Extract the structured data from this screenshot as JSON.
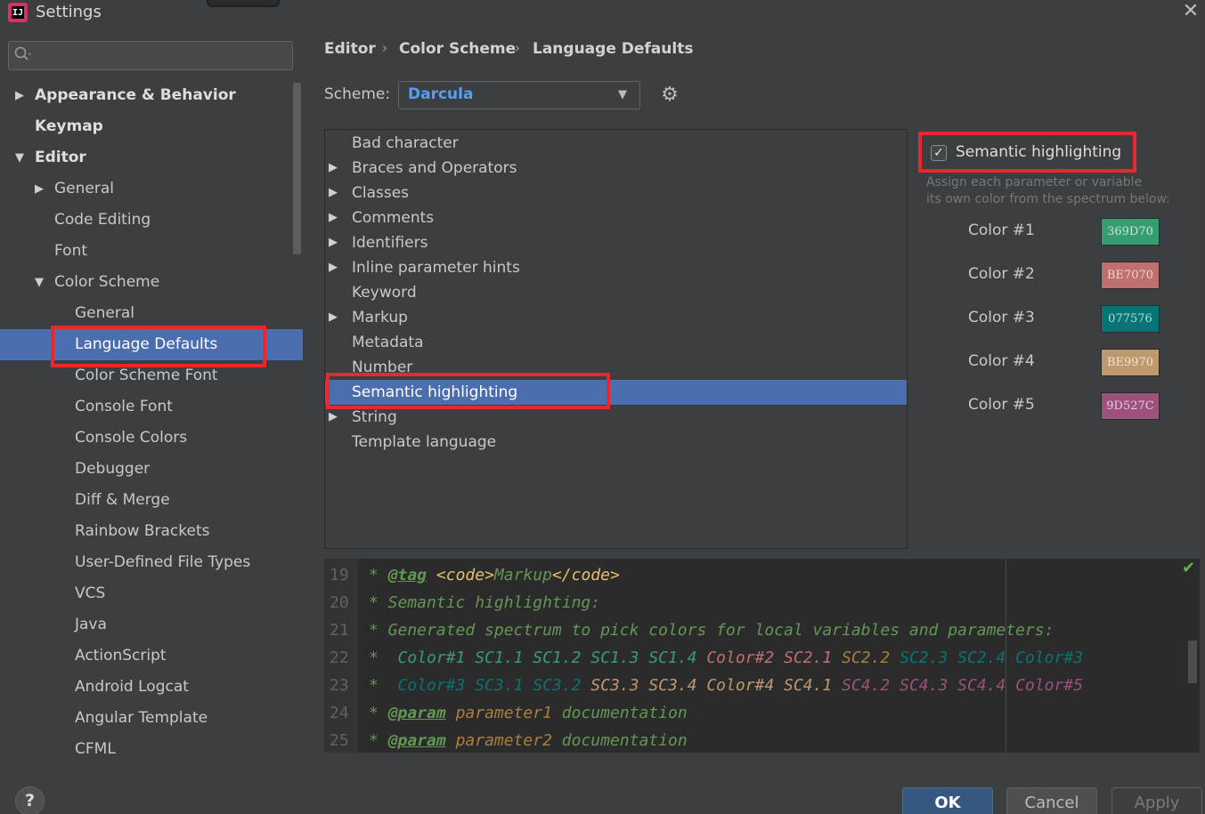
{
  "window": {
    "title": "Settings",
    "app_icon": "intellij-icon",
    "close_icon": "close-icon"
  },
  "search": {
    "placeholder": "",
    "icon": "search-icon"
  },
  "sidebar": {
    "items": [
      {
        "label": "Appearance & Behavior",
        "level": 0,
        "bold": true,
        "expanded": false,
        "expandable": true
      },
      {
        "label": "Keymap",
        "level": 0,
        "bold": true,
        "expandable": false
      },
      {
        "label": "Editor",
        "level": 0,
        "bold": true,
        "expanded": true,
        "expandable": true
      },
      {
        "label": "General",
        "level": 1,
        "expanded": false,
        "expandable": true
      },
      {
        "label": "Code Editing",
        "level": 1
      },
      {
        "label": "Font",
        "level": 1
      },
      {
        "label": "Color Scheme",
        "level": 1,
        "expanded": true,
        "expandable": true
      },
      {
        "label": "General",
        "level": 2
      },
      {
        "label": "Language Defaults",
        "level": 2,
        "selected": true
      },
      {
        "label": "Color Scheme Font",
        "level": 2
      },
      {
        "label": "Console Font",
        "level": 2
      },
      {
        "label": "Console Colors",
        "level": 2
      },
      {
        "label": "Debugger",
        "level": 2
      },
      {
        "label": "Diff & Merge",
        "level": 2
      },
      {
        "label": "Rainbow Brackets",
        "level": 2
      },
      {
        "label": "User-Defined File Types",
        "level": 2
      },
      {
        "label": "VCS",
        "level": 2
      },
      {
        "label": "Java",
        "level": 2
      },
      {
        "label": "ActionScript",
        "level": 2
      },
      {
        "label": "Android Logcat",
        "level": 2
      },
      {
        "label": "Angular Template",
        "level": 2
      },
      {
        "label": "CFML",
        "level": 2
      }
    ]
  },
  "breadcrumb": {
    "items": [
      "Editor",
      "Color Scheme",
      "Language Defaults"
    ],
    "separator": "›"
  },
  "scheme": {
    "label": "Scheme:",
    "value": "Darcula",
    "settings_icon": "gear-icon"
  },
  "tree": {
    "items": [
      {
        "label": "Bad character",
        "expandable": false
      },
      {
        "label": "Braces and Operators",
        "expandable": true
      },
      {
        "label": "Classes",
        "expandable": true
      },
      {
        "label": "Comments",
        "expandable": true
      },
      {
        "label": "Identifiers",
        "expandable": true
      },
      {
        "label": "Inline parameter hints",
        "expandable": true
      },
      {
        "label": "Keyword",
        "expandable": false
      },
      {
        "label": "Markup",
        "expandable": true
      },
      {
        "label": "Metadata",
        "expandable": false
      },
      {
        "label": "Number",
        "expandable": false
      },
      {
        "label": "Semantic highlighting",
        "expandable": false,
        "selected": true
      },
      {
        "label": "String",
        "expandable": true
      },
      {
        "label": "Template language",
        "expandable": false
      }
    ]
  },
  "semantic": {
    "checkbox_label": "Semantic highlighting",
    "checked": true,
    "hint_line1": "Assign each parameter or variable",
    "hint_line2": "its own color from the spectrum below:",
    "colors": [
      {
        "label": "Color #1",
        "hex": "369D70",
        "fg": "#c8e6d6"
      },
      {
        "label": "Color #2",
        "hex": "BE7070",
        "fg": "#f0d0d0"
      },
      {
        "label": "Color #3",
        "hex": "077576",
        "fg": "#b6dede"
      },
      {
        "label": "Color #4",
        "hex": "BE9970",
        "fg": "#f3e2cc"
      },
      {
        "label": "Color #5",
        "hex": "9D527C",
        "fg": "#e9c9dc"
      }
    ]
  },
  "preview": {
    "lines": [
      {
        "n": "19",
        "segs": [
          [
            "* ",
            ""
          ],
          [
            "@tag",
            "tg"
          ],
          [
            " ",
            ""
          ],
          [
            "<code>",
            "mk"
          ],
          [
            "Markup",
            ""
          ],
          [
            "</code>",
            "mk"
          ]
        ]
      },
      {
        "n": "20",
        "segs": [
          [
            "* Semantic highlighting:",
            ""
          ]
        ]
      },
      {
        "n": "21",
        "segs": [
          [
            "* Generated spectrum to pick colors for local variables and parameters:",
            ""
          ]
        ]
      },
      {
        "n": "22",
        "segs": [
          [
            "*  ",
            ""
          ],
          [
            "Color#1",
            "c1"
          ],
          [
            " ",
            ""
          ],
          [
            "SC1.1",
            "c1"
          ],
          [
            " ",
            ""
          ],
          [
            "SC1.2",
            "c1"
          ],
          [
            " ",
            ""
          ],
          [
            "SC1.3",
            "c1"
          ],
          [
            " ",
            ""
          ],
          [
            "SC1.4",
            "c1"
          ],
          [
            " ",
            ""
          ],
          [
            "Color#2",
            "c2"
          ],
          [
            " ",
            ""
          ],
          [
            "SC2.1",
            "c2"
          ],
          [
            " ",
            ""
          ],
          [
            "SC2.2",
            "pm"
          ],
          [
            " ",
            ""
          ],
          [
            "SC2.3",
            "c3"
          ],
          [
            " ",
            ""
          ],
          [
            "SC2.4",
            "c3"
          ],
          [
            " ",
            ""
          ],
          [
            "Color#3",
            "c3"
          ]
        ]
      },
      {
        "n": "23",
        "segs": [
          [
            "*  ",
            ""
          ],
          [
            "Color#3",
            "c3"
          ],
          [
            " ",
            ""
          ],
          [
            "SC3.1",
            "c3"
          ],
          [
            " ",
            ""
          ],
          [
            "SC3.2",
            "c3"
          ],
          [
            " ",
            ""
          ],
          [
            "SC3.3",
            "c4"
          ],
          [
            " ",
            ""
          ],
          [
            "SC3.4",
            "c4"
          ],
          [
            " ",
            ""
          ],
          [
            "Color#4",
            "c4"
          ],
          [
            " ",
            ""
          ],
          [
            "SC4.1",
            "c4"
          ],
          [
            " ",
            ""
          ],
          [
            "SC4.2",
            "c5"
          ],
          [
            " ",
            ""
          ],
          [
            "SC4.3",
            "c5"
          ],
          [
            " ",
            ""
          ],
          [
            "SC4.4",
            "c5"
          ],
          [
            " ",
            ""
          ],
          [
            "Color#5",
            "c5"
          ]
        ]
      },
      {
        "n": "24",
        "segs": [
          [
            "* ",
            ""
          ],
          [
            "@param",
            "tg"
          ],
          [
            " ",
            ""
          ],
          [
            "parameter1",
            "pm"
          ],
          [
            " documentation",
            ""
          ]
        ]
      },
      {
        "n": "25",
        "segs": [
          [
            "* ",
            ""
          ],
          [
            "@param",
            "tg"
          ],
          [
            " ",
            ""
          ],
          [
            "parameter2",
            "pm"
          ],
          [
            " documentation",
            ""
          ]
        ]
      }
    ],
    "status_icon": "checkmark-icon"
  },
  "buttons": {
    "help": "?",
    "ok": "OK",
    "cancel": "Cancel",
    "apply": "Apply"
  },
  "colors": {
    "background": "#3c3f41",
    "selection": "#4b6eaf",
    "highlight_box": "#e8282d",
    "accent": "#589df6",
    "editor_bg": "#2b2b2b"
  }
}
